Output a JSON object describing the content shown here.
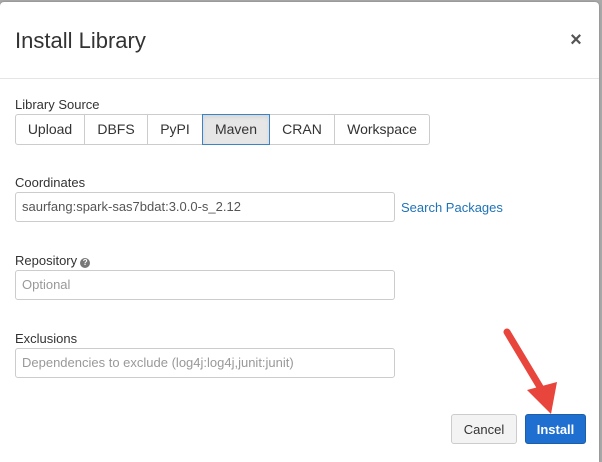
{
  "dialog": {
    "title": "Install Library",
    "close_label": "×"
  },
  "library_source": {
    "label": "Library Source",
    "options": [
      "Upload",
      "DBFS",
      "PyPI",
      "Maven",
      "CRAN",
      "Workspace"
    ],
    "selected": "Maven"
  },
  "coordinates": {
    "label": "Coordinates",
    "value": "saurfang:spark-sas7bdat:3.0.0-s_2.12",
    "search_link": "Search Packages"
  },
  "repository": {
    "label": "Repository",
    "help_icon": "question-circle-icon",
    "placeholder": "Optional"
  },
  "exclusions": {
    "label": "Exclusions",
    "placeholder": "Dependencies to exclude (log4j:log4j,junit:junit)"
  },
  "footer": {
    "cancel_label": "Cancel",
    "install_label": "Install"
  },
  "colors": {
    "primary": "#1f6fd1",
    "link": "#1f73b7",
    "annotation_arrow": "#e8453c"
  }
}
